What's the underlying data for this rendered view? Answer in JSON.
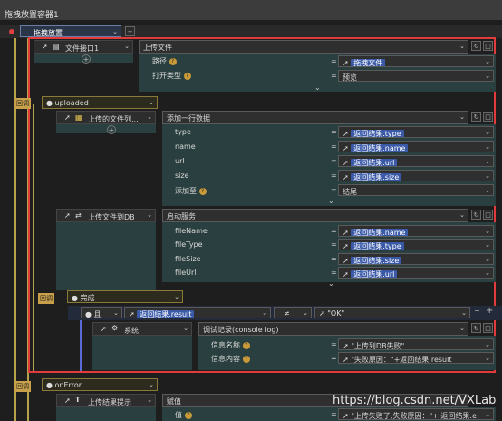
{
  "title": "拖拽放置容器1",
  "root": {
    "label": "拖拽放置"
  },
  "fileIf": {
    "label": "文件接口1",
    "action": "上传文件",
    "params": [
      {
        "name": "路径",
        "value": "拖拽文件"
      },
      {
        "name": "打开类型",
        "value": "预览"
      }
    ]
  },
  "callback1": {
    "tag": "回调",
    "event": "uploaded"
  },
  "listNode": {
    "label": "上传的文件列...",
    "action": "添加一行数据",
    "params": [
      {
        "name": "type",
        "value": "返回结果.type"
      },
      {
        "name": "name",
        "value": "返回结果.name"
      },
      {
        "name": "url",
        "value": "返回结果.url"
      },
      {
        "name": "size",
        "value": "返回结果.size"
      },
      {
        "name": "添加至",
        "value": "结尾"
      }
    ]
  },
  "uploadDb": {
    "label": "上传文件到DB",
    "action": "启动服务",
    "params": [
      {
        "name": "fileName",
        "value": "返回结果.name"
      },
      {
        "name": "fileType",
        "value": "返回结果.type"
      },
      {
        "name": "fileSize",
        "value": "返回结果.size"
      },
      {
        "name": "fileUrl",
        "value": "返回结果.url"
      }
    ]
  },
  "callback2": {
    "tag": "回调",
    "event": "完成"
  },
  "cond": {
    "keyword": "且",
    "left": "返回结果.result",
    "op": "≠",
    "right": "\"OK\""
  },
  "sysNode": {
    "label": "系统",
    "action": "调试记录(console log)",
    "params": [
      {
        "name": "信息名称",
        "value": "\"上传到DB失败\""
      },
      {
        "name": "信息内容",
        "value": "\"失败原因：\"+返回结果.result"
      }
    ]
  },
  "callback3": {
    "tag": "回调",
    "event": "onError"
  },
  "tipNode": {
    "label": "上传结果提示",
    "action": "赋值",
    "params": [
      {
        "name": "值",
        "value": "\"上传失败了,失败原因：\"+ 返回结果.e"
      }
    ]
  },
  "watermark": "https://blog.csdn.net/VXLab"
}
